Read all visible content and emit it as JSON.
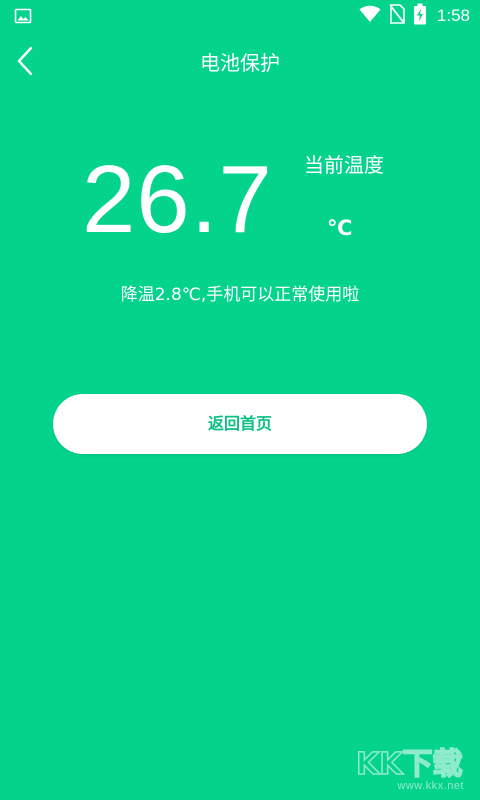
{
  "status_bar": {
    "time": "1:58",
    "icons": [
      "image-icon",
      "wifi-icon",
      "no-sim-icon",
      "battery-charging-icon"
    ]
  },
  "toolbar": {
    "back_icon": "chevron-left-icon",
    "title": "电池保护"
  },
  "temperature": {
    "value": "26.7",
    "label": "当前温度",
    "unit": "℃"
  },
  "message": "降温2.8℃,手机可以正常使用啦",
  "home_button": {
    "label": "返回首页"
  },
  "watermark": {
    "logo_text": "KK下载",
    "url": "www.kkx.net"
  },
  "colors": {
    "background": "#04d38c",
    "button_bg": "#ffffff",
    "button_text": "#0cbf82"
  }
}
